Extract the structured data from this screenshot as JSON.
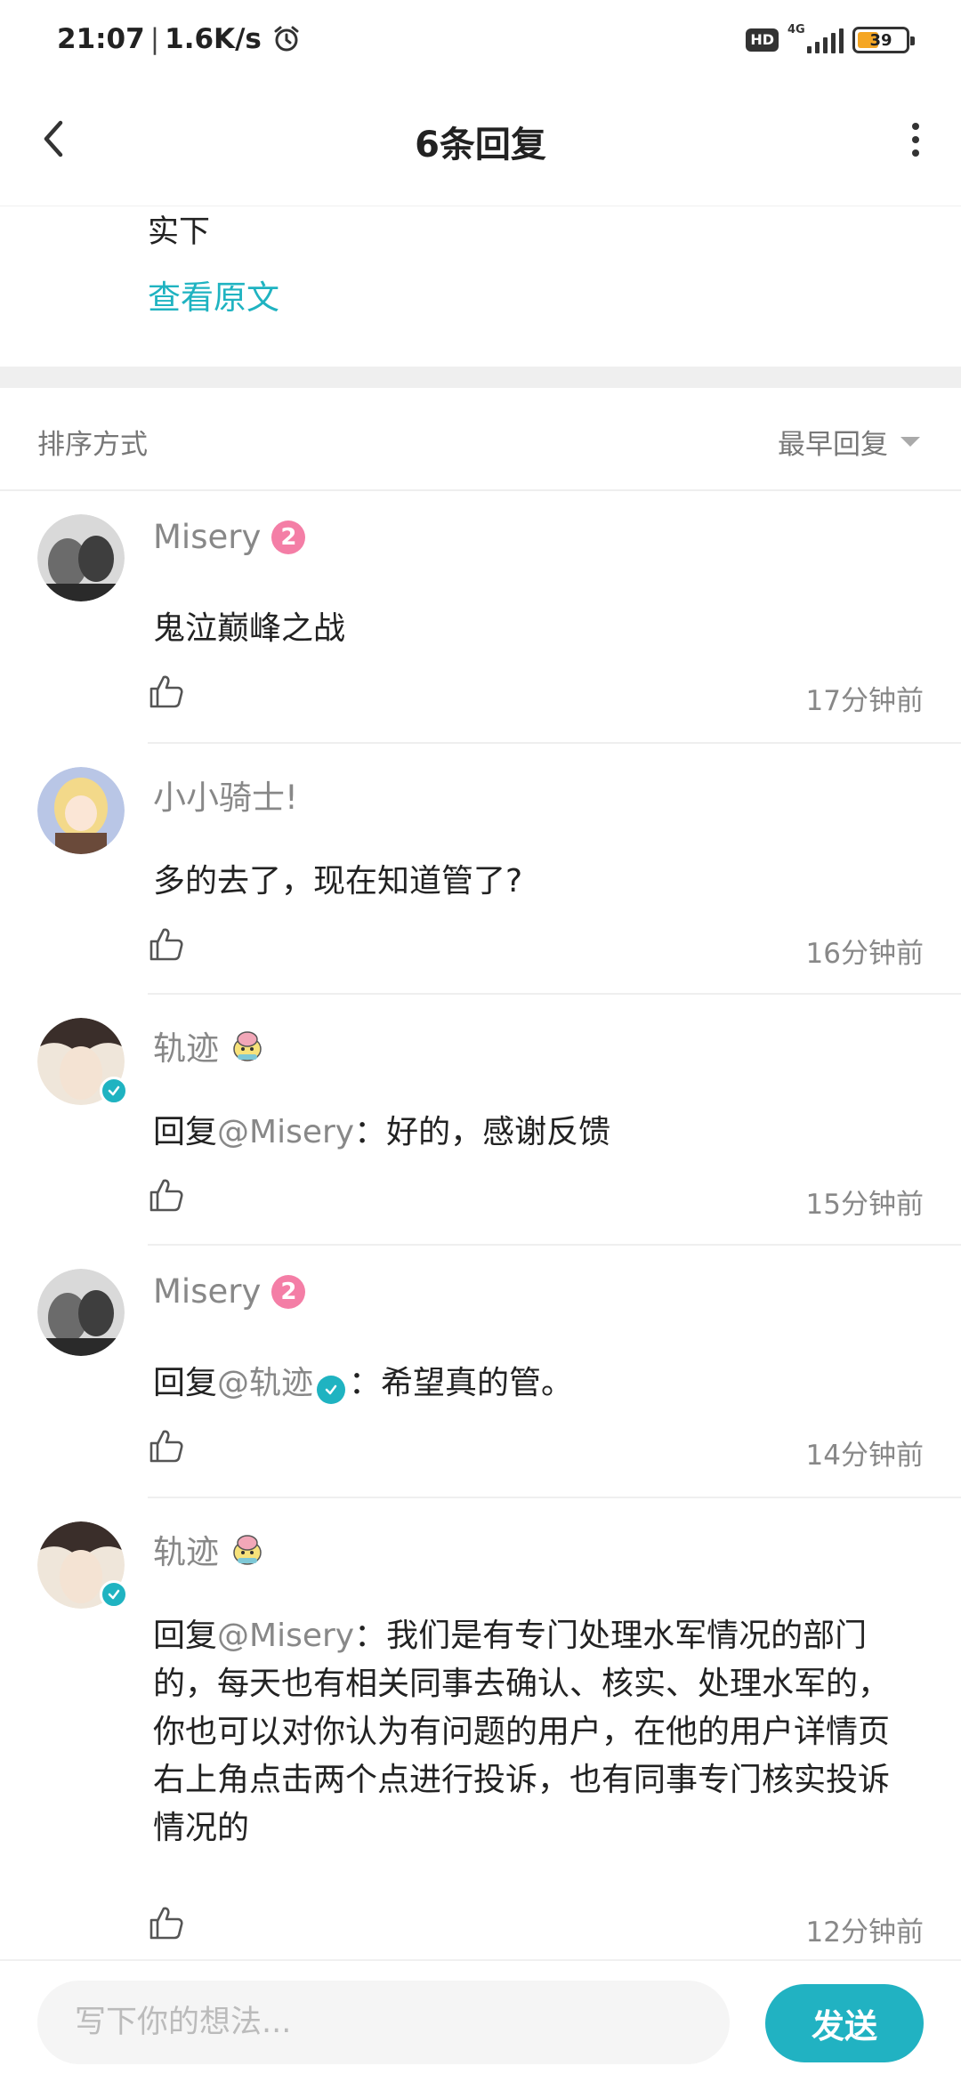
{
  "status_bar": {
    "time": "21:07",
    "separator": "|",
    "speed": "1.6K/s",
    "hd_label": "HD",
    "network_type": "4G",
    "battery_level": "39",
    "icons": [
      "alarm-clock-icon",
      "signal-icon",
      "battery-icon"
    ]
  },
  "header": {
    "title": "6条回复",
    "back_icon": "chevron-left-icon",
    "more_icon": "more-vertical-icon"
  },
  "post": {
    "tail_text": "实下",
    "view_original": "查看原文"
  },
  "sort": {
    "label": "排序方式",
    "value": "最早回复"
  },
  "replies": [
    {
      "username": "Misery",
      "level": "2",
      "content": "鬼泣巅峰之战",
      "time": "17分钟前"
    },
    {
      "username": "小小骑士!",
      "content": "多的去了，现在知道管了?",
      "time": "16分钟前"
    },
    {
      "username": "轨迹",
      "verified": true,
      "reply_prefix": "回复",
      "mention": "@Misery",
      "content": "：好的，感谢反馈",
      "time": "15分钟前"
    },
    {
      "username": "Misery",
      "level": "2",
      "reply_prefix": "回复",
      "mention": "@轨迹",
      "content": "：希望真的管。",
      "time": "14分钟前"
    },
    {
      "username": "轨迹",
      "verified": true,
      "reply_prefix": "回复",
      "mention": "@Misery",
      "content": "：我们是有专门处理水军情况的部门的，每天也有相关同事去确认、核实、处理水军的，你也可以对你认为有问题的用户，在他的用户详情页右上角点击两个点进行投诉，也有同事专门核实投诉情况的",
      "time": "12分钟前"
    }
  ],
  "input": {
    "placeholder": "写下你的想法...",
    "send_label": "发送"
  },
  "colors": {
    "accent": "#1fb3c1",
    "level_badge": "#f47ea6",
    "muted_text": "#888888"
  }
}
